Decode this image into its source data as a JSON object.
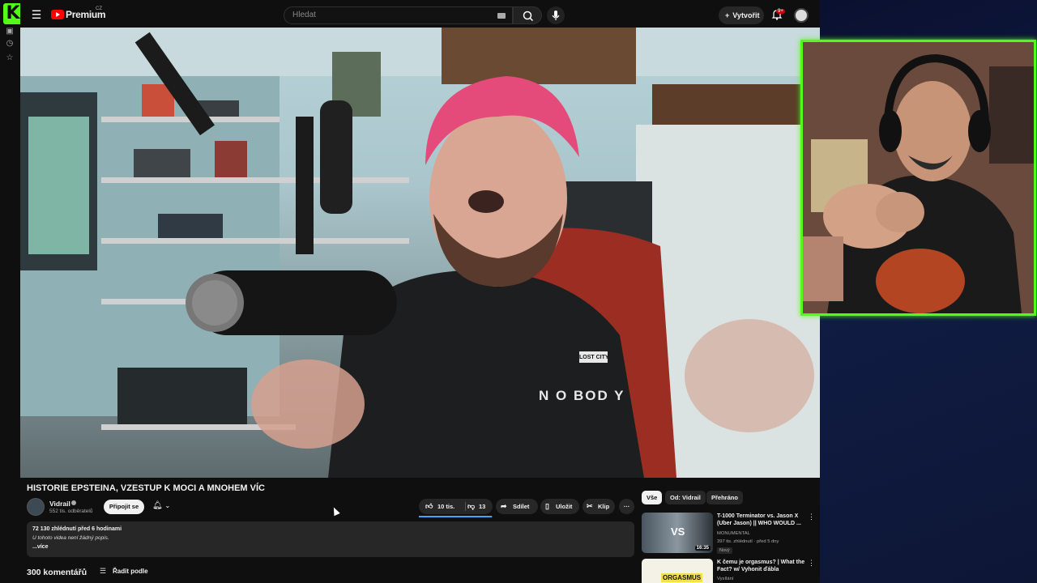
{
  "app": {
    "kick_logo_letter": "K",
    "brand": "Premium",
    "region": "CZ"
  },
  "topbar": {
    "search_placeholder": "Hledat",
    "create_label": "Vytvořit",
    "notifications_badge": "9+",
    "icons": [
      "menu-icon",
      "youtube-logo-icon",
      "keyboard-icon",
      "search-icon",
      "mic-icon",
      "plus-icon",
      "bell-icon",
      "avatar-icon"
    ]
  },
  "video": {
    "title": "HISTORIE EPSTEINA, VZESTUP K MOCI A MNOHEM VÍC",
    "channel": {
      "name": "Vidrail",
      "subscribers": "552 tis. odběratelů",
      "join_label": "Připojit se"
    },
    "actions": {
      "likes": "10 tis.",
      "dislikes": "13",
      "like_ratio": 0.99,
      "share": "Sdílet",
      "save": "Uložit",
      "clip": "Klip",
      "more": "···"
    },
    "description": {
      "views_and_time": "72 130 zhlédnutí  před 6 hodinami",
      "text": "U tohoto videa není žádný popis.",
      "more": "...více"
    },
    "shirt_text": "N O BOD Y",
    "patch_text": "LOST CITY"
  },
  "comments": {
    "count_label": "300 komentářů",
    "sort_label": "Řadit podle"
  },
  "sidebar_right": {
    "chips": [
      {
        "label": "Vše",
        "active": true
      },
      {
        "label": "Od: Vidrail",
        "active": false
      },
      {
        "label": "Přehráno",
        "active": false
      }
    ],
    "recommendations": [
      {
        "title": "T-1000 Terminator vs. Jason X (Uber Jason) || WHO WOULD ...",
        "channel": "MONUMENTAL",
        "meta": "397 tis. zhlédnutí · před 5 dny",
        "badge": "Nový",
        "duration": "16:35",
        "thumb_text": "VS"
      },
      {
        "title": "K čemu je orgasmus? | What the Fact? w/ Vyhonit ďábla",
        "channel": "Vysílání",
        "meta": "",
        "badge": "",
        "duration": "",
        "thumb_text": "ORGASMUS"
      }
    ]
  },
  "colors": {
    "kick_green": "#53fc18",
    "yt_red": "#ff0000",
    "background": "#0f0f0f",
    "pill": "#272727"
  }
}
